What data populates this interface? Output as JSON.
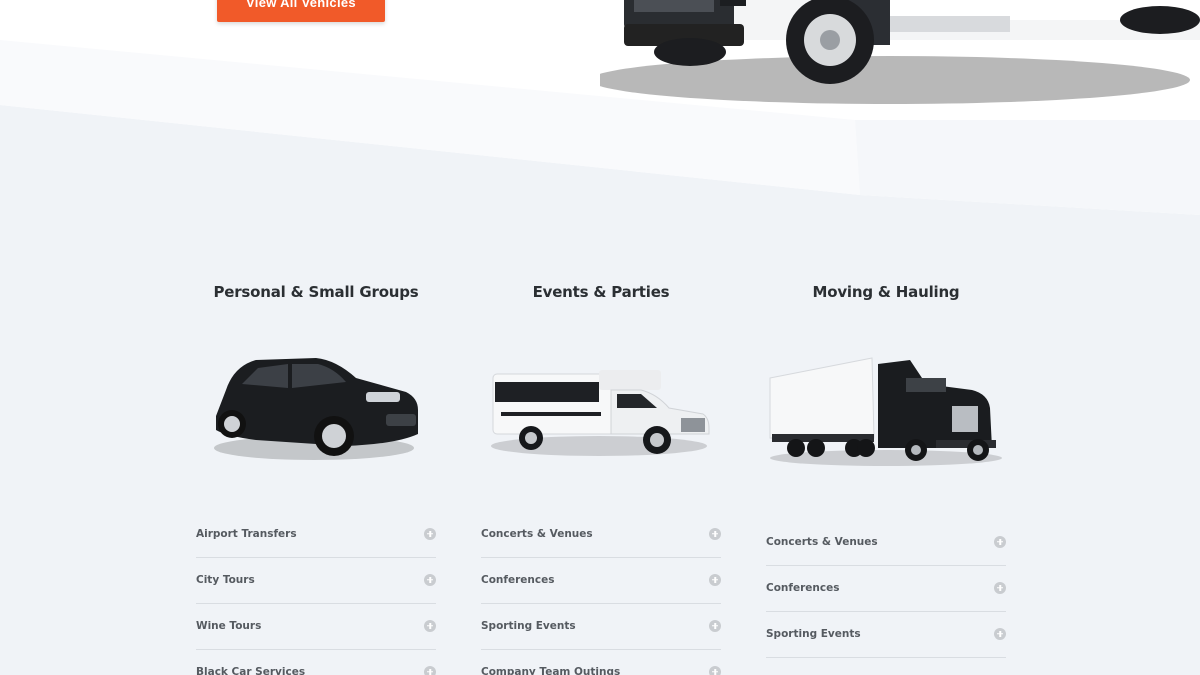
{
  "hero": {
    "cta_label": "View All Vehicles"
  },
  "categories": [
    {
      "title": "Personal & Small Groups",
      "vehicle_icon": "suv-icon",
      "services": [
        "Airport Transfers",
        "City Tours",
        "Wine Tours",
        "Black Car Services"
      ]
    },
    {
      "title": "Events & Parties",
      "vehicle_icon": "party-bus-icon",
      "services": [
        "Concerts & Venues",
        "Conferences",
        "Sporting Events",
        "Company Team Outings"
      ]
    },
    {
      "title": "Moving & Hauling",
      "vehicle_icon": "semi-truck-icon",
      "services": [
        "Concerts & Venues",
        "Conferences",
        "Sporting Events"
      ]
    }
  ],
  "colors": {
    "accent": "#f15a29",
    "background": "#f0f3f7",
    "divider": "#d9dde2"
  }
}
